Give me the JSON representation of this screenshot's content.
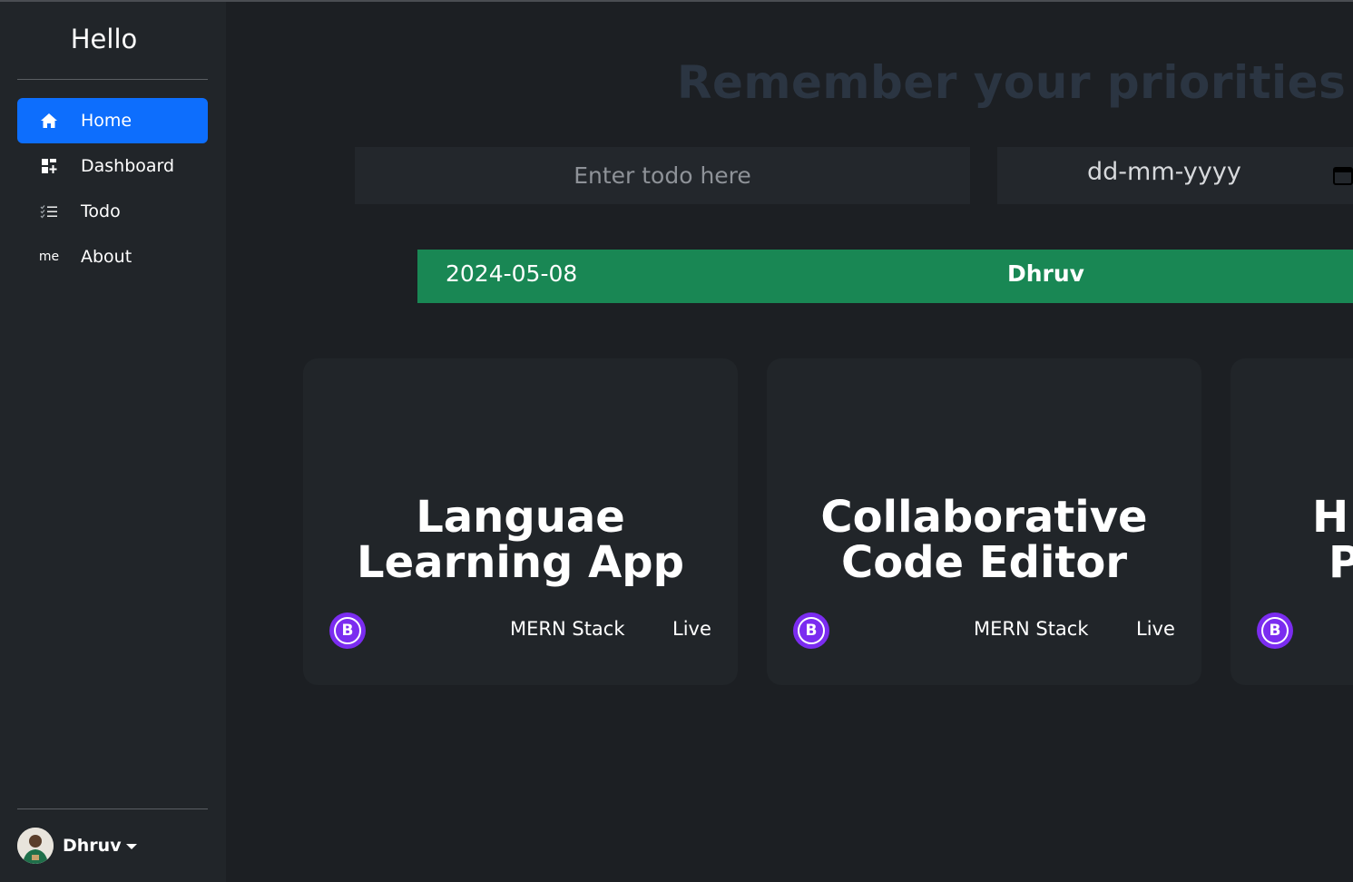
{
  "sidebar": {
    "brand": "Hello",
    "items": [
      {
        "label": "Home",
        "icon": "home-icon",
        "active": true
      },
      {
        "label": "Dashboard",
        "icon": "dashboard-icon",
        "active": false
      },
      {
        "label": "Todo",
        "icon": "list-check-icon",
        "active": false
      },
      {
        "label": "About",
        "icon": "me-text-icon",
        "icon_text": "me",
        "active": false
      }
    ],
    "user": {
      "name": "Dhruv",
      "avatar": "avatar-icon"
    }
  },
  "main": {
    "headline": "Remember your priorities !",
    "todo_placeholder": "Enter todo here",
    "date_placeholder": "dd-mm-yyyy",
    "banner": {
      "date": "2024-05-08",
      "name": "Dhruv"
    },
    "cards": [
      {
        "title_line1": "Languae",
        "title_line2": "Learning App",
        "stack": "MERN Stack",
        "status": "Live",
        "badge": "B"
      },
      {
        "title_line1": "Collaborative",
        "title_line2": "Code Editor",
        "stack": "MERN Stack",
        "status": "Live",
        "badge": "B"
      },
      {
        "title_line1": "H",
        "title_line2": "P",
        "badge": "B"
      }
    ]
  },
  "colors": {
    "background": "#1c1f23",
    "sidebar": "#212529",
    "active": "#0d6efd",
    "banner": "#198754",
    "headline": "#2b3542",
    "badge": "#7b2cf0"
  }
}
